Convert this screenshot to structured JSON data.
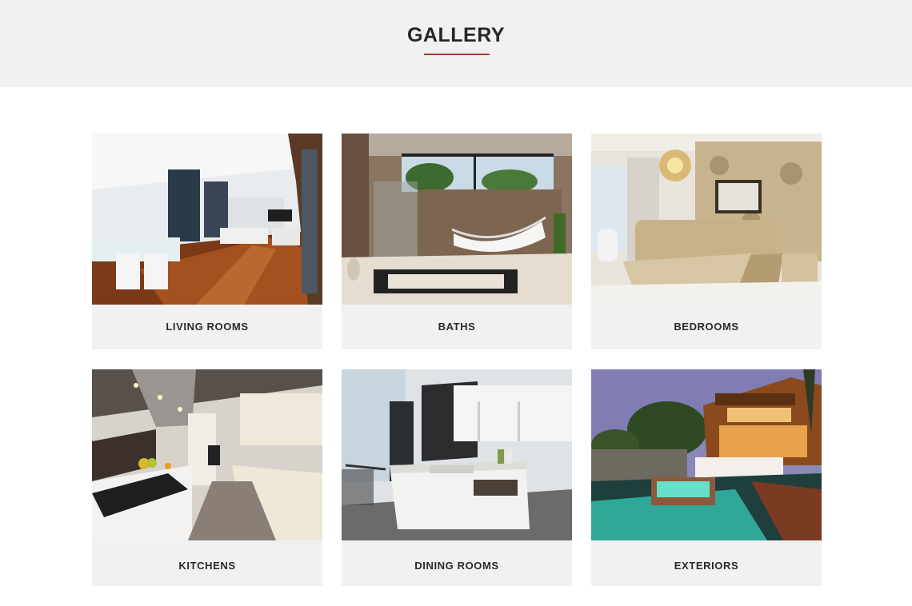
{
  "page": {
    "title": "GALLERY",
    "accent_color": "#a63a3a"
  },
  "gallery": {
    "items": [
      {
        "label": "LIVING ROOMS"
      },
      {
        "label": "BATHS"
      },
      {
        "label": "BEDROOMS"
      },
      {
        "label": "KITCHENS"
      },
      {
        "label": "DINING ROOMS"
      },
      {
        "label": "EXTERIORS"
      }
    ]
  }
}
